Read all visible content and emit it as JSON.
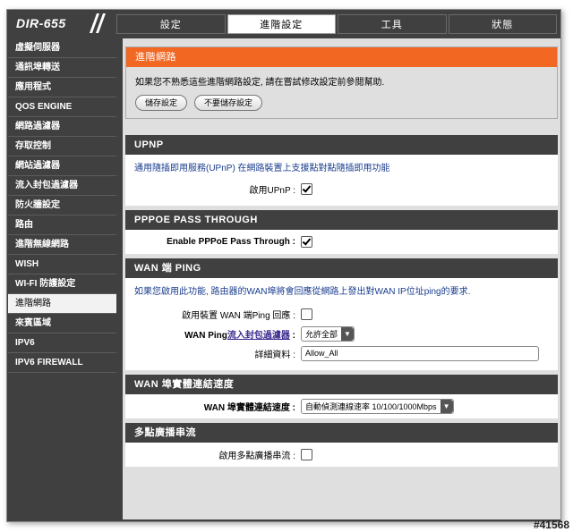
{
  "header": {
    "logo": "DIR-655",
    "tabs": [
      "設定",
      "進階設定",
      "工具",
      "狀態"
    ],
    "active_tab": "進階設定"
  },
  "sidebar": {
    "items": [
      {
        "label": "虛擬伺服器"
      },
      {
        "label": "通訊埠轉送"
      },
      {
        "label": "應用程式"
      },
      {
        "label": "QOS ENGINE"
      },
      {
        "label": "網路過濾器"
      },
      {
        "label": "存取控制"
      },
      {
        "label": "網站過濾器"
      },
      {
        "label": "流入封包過濾器"
      },
      {
        "label": "防火牆設定"
      },
      {
        "label": "路由"
      },
      {
        "label": "進階無線網路"
      },
      {
        "label": "WISH"
      },
      {
        "label": "WI-FI 防護設定"
      },
      {
        "label": "進階網路"
      },
      {
        "label": "來賓區域"
      },
      {
        "label": "IPV6"
      },
      {
        "label": "IPV6 FIREWALL"
      }
    ],
    "active_label": "進階網路"
  },
  "intro": {
    "title": "進階網路",
    "text": "如果您不熟悉這些進階網路設定, 請在嘗試修改設定前參閱幫助.",
    "save_label": "儲存設定",
    "nosave_label": "不要儲存設定"
  },
  "upnp": {
    "title": "UPNP",
    "desc": "通用隨插即用服務(UPnP) 在網路裝置上支援點對點隨插即用功能",
    "enable_label": "啟用UPnP :",
    "enabled": true
  },
  "pppoe": {
    "title": "PPPOE PASS THROUGH",
    "enable_label": "Enable PPPoE Pass Through :",
    "enabled": true
  },
  "wanping": {
    "title": "WAN 端 PING",
    "desc": "如果您啟用此功能, 路由器的WAN埠將會回應從網路上發出對WAN IP位址ping的要求.",
    "enable_label": "啟用裝置 WAN 端Ping 回應 :",
    "enabled": false,
    "filter_label_prefix": "WAN Ping",
    "filter_link": "流入封包過濾器",
    "filter_colon": " :",
    "filter_value": "允許全部",
    "details_label": "詳細資料 :",
    "details_value": "Allow_All"
  },
  "wanspeed": {
    "title": "WAN 埠實體連結速度",
    "label": "WAN 埠實體連結速度 :",
    "value": "自動偵測連線速率 10/100/1000Mbps"
  },
  "multicast": {
    "title": "多點廣播串流",
    "label": "啟用多點廣播串流 :",
    "enabled": false
  },
  "watermark": "#41568"
}
